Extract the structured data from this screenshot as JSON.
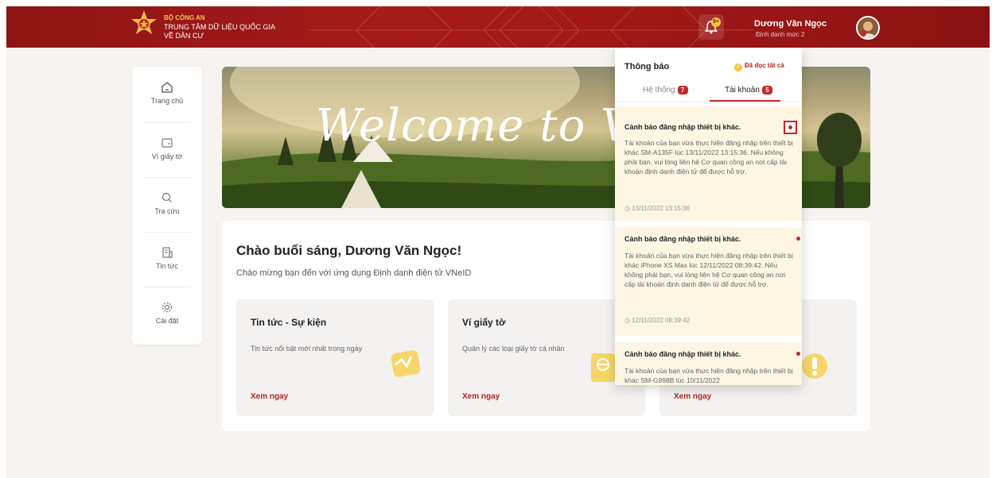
{
  "header": {
    "brand_line1": "BỘ CÔNG AN",
    "brand_line2": "TRUNG TÂM DỮ LIỆU QUỐC GIA",
    "brand_line3": "VỀ DÂN CƯ",
    "user_name": "Dương Văn Ngọc",
    "user_level": "Định danh mức 2"
  },
  "sidebar": {
    "items": [
      {
        "label": "Trang chủ",
        "icon": "home-icon"
      },
      {
        "label": "Ví giấy tờ",
        "icon": "wallet-icon"
      },
      {
        "label": "Tra cứu",
        "icon": "search-icon"
      },
      {
        "label": "Tin tức",
        "icon": "news-icon"
      },
      {
        "label": "Cài đặt",
        "icon": "gear-icon"
      }
    ]
  },
  "banner": {
    "text": "Welcome to V"
  },
  "main": {
    "greeting": "Chào buổi sáng, Dương Văn Ngọc!",
    "subtitle": "Chào mừng bạn đến với ứng dụng Định danh điện tử VNeID",
    "tiles": [
      {
        "title": "Tin tức - Sự kiện",
        "desc": "Tin tức nổi bật mới nhất trong ngày",
        "link": "Xem ngay"
      },
      {
        "title": "Ví giấy tờ",
        "desc": "Quản lý các loại giấy tờ cá nhân",
        "link": "Xem ngay"
      },
      {
        "title": "",
        "desc": "",
        "link": "Xem ngay"
      }
    ]
  },
  "notifications": {
    "title": "Thông báo",
    "read_all": "Đã đọc tất cả",
    "tabs": [
      {
        "label": "Hệ thống",
        "count": "7"
      },
      {
        "label": "Tài khoản",
        "count": "5"
      }
    ],
    "items": [
      {
        "title": "Cảnh báo đăng nhập thiết bị khác.",
        "body": "Tài khoản của bạn vừa thực hiện đăng nhập trên thiết bị khác SM-A135F lúc 13/11/2022 13:15:36. Nếu không phải bạn, vui lòng liên hệ Cơ quan công an nơi cấp tài khoản định danh điện tử để được hỗ trợ.",
        "time": "13/11/2022 13:15:36"
      },
      {
        "title": "Cảnh báo đăng nhập thiết bị khác.",
        "body": "Tài khoản của bạn vừa thực hiện đăng nhập trên thiết bị khác iPhone XS Max lúc 12/11/2022 08:39:42. Nếu không phải bạn, vui lòng liên hệ Cơ quan công an nơi cấp tài khoản định danh điện tử để được hỗ trợ.",
        "time": "12/11/2022 08:39:42"
      },
      {
        "title": "Cảnh báo đăng nhập thiết bị khác.",
        "body": "Tài khoản của bạn vừa thực hiện đăng nhập trên thiết bị khác SM-G998B lúc 10/11/2022",
        "time": ""
      }
    ]
  },
  "colors": {
    "brand_red": "#9d1717",
    "accent_gold": "#f6c445",
    "link_red": "#b32424"
  }
}
